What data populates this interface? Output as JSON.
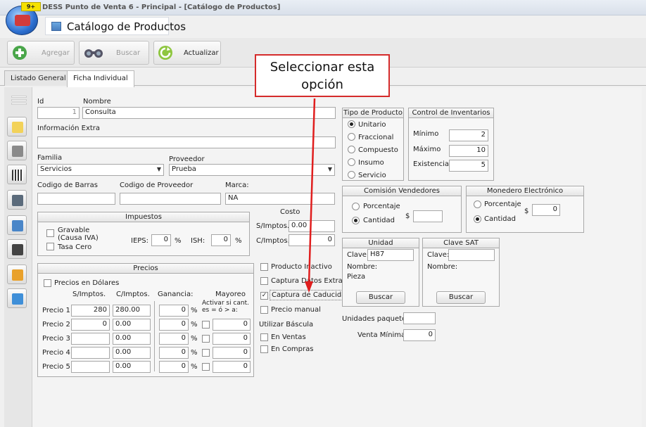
{
  "window": {
    "title": "DESS Punto de Venta 6 - Principal - [Catálogo de Productos]",
    "badge": "9+"
  },
  "doc": {
    "title": "Catálogo de Productos"
  },
  "toolbar": {
    "add": "Agregar",
    "search": "Buscar",
    "refresh": "Actualizar"
  },
  "tabs": [
    "Listado General",
    "Ficha Individual"
  ],
  "form": {
    "id_label": "Id",
    "id_value": "1",
    "name_label": "Nombre",
    "name_value": "Consulta",
    "extra_label": "Información Extra",
    "extra_value": "",
    "family_label": "Familia",
    "family_value": "Servicios",
    "supplier_label": "Proveedor",
    "supplier_value": "Prueba",
    "barcode_label": "Codigo de Barras",
    "barcode_value": "",
    "supplier_code_label": "Codigo de Proveedor",
    "supplier_code_value": "",
    "brand_label": "Marca:",
    "brand_value": "NA"
  },
  "taxes": {
    "title": "Impuestos",
    "gravable": "Gravable (Causa IVA)",
    "tasa_cero": "Tasa Cero",
    "ieps_label": "IEPS:",
    "ieps_value": "0",
    "ish_label": "ISH:",
    "ish_value": "0",
    "pct": "%"
  },
  "cost": {
    "title": "Costo",
    "s_label": "S/Imptos.",
    "s_value": "0.00",
    "c_label": "C/Imptos.",
    "c_value": "0"
  },
  "prices": {
    "title": "Precios",
    "usd": "Precios en Dólares",
    "h_s": "S/Imptos.",
    "h_c": "C/Imptos.",
    "h_gain": "Ganancia:",
    "h_mayoreo": "Mayoreo",
    "activar": "Activar si cant. es = ó > a:",
    "rows": [
      {
        "label": "Precio 1:",
        "s": "280",
        "c": "280.00",
        "g": "0",
        "m": ""
      },
      {
        "label": "Precio 2:",
        "s": "0",
        "c": "0.00",
        "g": "0",
        "m": "0"
      },
      {
        "label": "Precio 3:",
        "s": "",
        "c": "0.00",
        "g": "0",
        "m": "0"
      },
      {
        "label": "Precio 4:",
        "s": "",
        "c": "0.00",
        "g": "0",
        "m": "0"
      },
      {
        "label": "Precio 5:",
        "s": "",
        "c": "0.00",
        "g": "0",
        "m": "0"
      }
    ]
  },
  "options": {
    "inactive": "Producto Inactivo",
    "extra_data": "Captura Datos Extras",
    "expiry": "Captura de Caducidad",
    "manual": "Precio manual",
    "scale": "Utilizar Báscula",
    "sales": "En Ventas",
    "purchases": "En Compras"
  },
  "product_type": {
    "title": "Tipo de Producto",
    "items": [
      "Unitario",
      "Fraccional",
      "Compuesto",
      "Insumo",
      "Servicio"
    ]
  },
  "inventory": {
    "title": "Control de Inventarios",
    "min_label": "Mínimo",
    "min": "2",
    "max_label": "Máximo",
    "max": "10",
    "stock_label": "Existencia",
    "stock": "5"
  },
  "commission": {
    "title": "Comisión Vendedores",
    "pct": "Porcentaje",
    "amount": "Cantidad",
    "currency": "$",
    "value": ""
  },
  "wallet": {
    "title": "Monedero Electrónico",
    "pct": "Porcentaje",
    "amount": "Cantidad",
    "currency": "$",
    "value": "0"
  },
  "unit": {
    "title": "Unidad",
    "key_label": "Clave:",
    "key_value": "H87",
    "name_label": "Nombre:",
    "name_value": "Pieza",
    "search": "Buscar"
  },
  "sat": {
    "title": "Clave SAT",
    "key_label": "Clave:",
    "name_label": "Nombre:",
    "search": "Buscar"
  },
  "package": {
    "label": "Unidades paquete:",
    "value": ""
  },
  "min_sale": {
    "label": "Venta Mínima:",
    "value": "0"
  },
  "callout": {
    "line1": "Seleccionar esta",
    "line2": "opción"
  }
}
